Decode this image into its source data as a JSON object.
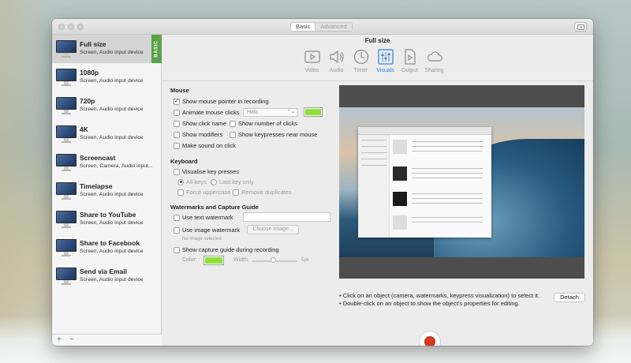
{
  "window": {
    "segments": [
      "Basic",
      "Advanced"
    ],
    "title": "Full size"
  },
  "sidebar": {
    "presets": [
      {
        "name": "Full size",
        "desc": "Screen, Audio input device",
        "selected": true
      },
      {
        "name": "1080p",
        "desc": "Screen, Audio input device"
      },
      {
        "name": "720p",
        "desc": "Screen, Audio input device"
      },
      {
        "name": "4K",
        "desc": "Screen, Audio input device"
      },
      {
        "name": "Screencast",
        "desc": "Screen, Camera, Audio input..."
      },
      {
        "name": "Timelapse",
        "desc": "Screen, Audio input device"
      },
      {
        "name": "Share to YouTube",
        "desc": "Screen, Audio input device"
      },
      {
        "name": "Share to Facebook",
        "desc": "Screen, Audio input device"
      },
      {
        "name": "Send via Email",
        "desc": "Screen, Audio input device"
      }
    ],
    "basic_tag": "BASIC",
    "add_label": "+",
    "remove_label": "−"
  },
  "tabs": [
    {
      "label": "Video",
      "icon": "video-icon"
    },
    {
      "label": "Audio",
      "icon": "speaker-icon"
    },
    {
      "label": "Timer",
      "icon": "clock-icon"
    },
    {
      "label": "Visuals",
      "icon": "visuals-icon",
      "active": true
    },
    {
      "label": "Output",
      "icon": "document-icon"
    },
    {
      "label": "Sharing",
      "icon": "cloud-icon"
    }
  ],
  "mouse": {
    "heading": "Mouse",
    "show_pointer": "Show mouse pointer in recording",
    "animate_clicks": "Animate mouse clicks",
    "animation_style": "Halo",
    "click_color": "#8fe03a",
    "show_click_name": "Show click name",
    "show_click_number": "Show number of clicks",
    "show_modifiers": "Show modifiers",
    "show_keypresses": "Show keypresses near mouse",
    "make_sound": "Make sound on click"
  },
  "keyboard": {
    "heading": "Keyboard",
    "visualise": "Visualise key presses",
    "all_keys": "All keys",
    "last_key": "Last key only",
    "force_upper": "Force uppercase",
    "remove_dupes": "Remove duplicates"
  },
  "watermarks": {
    "heading": "Watermarks and Capture Guide",
    "use_text": "Use text watermark",
    "use_image": "Use image watermark",
    "choose_image": "Choose Image...",
    "no_image": "No image selected",
    "show_guide": "Show capture guide during recording",
    "color_label": "Color:",
    "guide_color": "#8fe03a",
    "width_label": "Width:",
    "width_value": "5px"
  },
  "hints": {
    "line1": "• Click on an object (camera, watermarks, keypress visualization) to select it.",
    "line2": "• Double-click on an object to show the object's properties for editing."
  },
  "detach_label": "Detach"
}
